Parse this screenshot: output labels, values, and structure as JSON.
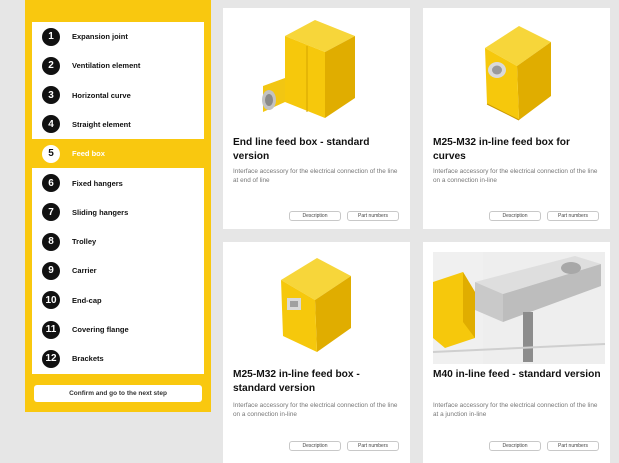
{
  "sidebar": {
    "items": [
      {
        "num": "1",
        "label": "Expansion joint"
      },
      {
        "num": "2",
        "label": "Ventilation element"
      },
      {
        "num": "3",
        "label": "Horizontal curve"
      },
      {
        "num": "4",
        "label": "Straight element"
      },
      {
        "num": "5",
        "label": "Feed box"
      },
      {
        "num": "6",
        "label": "Fixed hangers"
      },
      {
        "num": "7",
        "label": "Sliding hangers"
      },
      {
        "num": "8",
        "label": "Trolley"
      },
      {
        "num": "9",
        "label": "Carrier"
      },
      {
        "num": "10",
        "label": "End-cap"
      },
      {
        "num": "11",
        "label": "Covering flange"
      },
      {
        "num": "12",
        "label": "Brackets"
      }
    ],
    "active_index": 4,
    "confirm_label": "Confirm and go to the next step"
  },
  "products": [
    {
      "title": "End line feed box - standard version",
      "desc": "Interface accessory for the electrical connection of the line at end of line",
      "btn_description": "Description",
      "btn_part": "Part numbers"
    },
    {
      "title": "M25-M32 in-line feed box for curves",
      "desc": "Interface accessory for the electrical connection of the line on a connection in-line",
      "btn_description": "Description",
      "btn_part": "Part numbers"
    },
    {
      "title": "M25-M32 in-line feed box - standard version",
      "desc": "Interface accessory for the electrical connection of the line on a connection in-line",
      "btn_description": "Description",
      "btn_part": "Part numbers"
    },
    {
      "title": "M40 in-line feed - standard version",
      "desc": "Interface accessory for the electrical connection of the line at a junction in-line",
      "btn_description": "Description",
      "btn_part": "Part numbers"
    }
  ],
  "colors": {
    "accent": "#f9c80f",
    "product": "#f5cc16",
    "dark": "#111111"
  },
  "icons": [
    "feed-box-end-line-image",
    "feed-box-curves-image",
    "feed-box-standard-image",
    "feed-box-m40-image"
  ]
}
